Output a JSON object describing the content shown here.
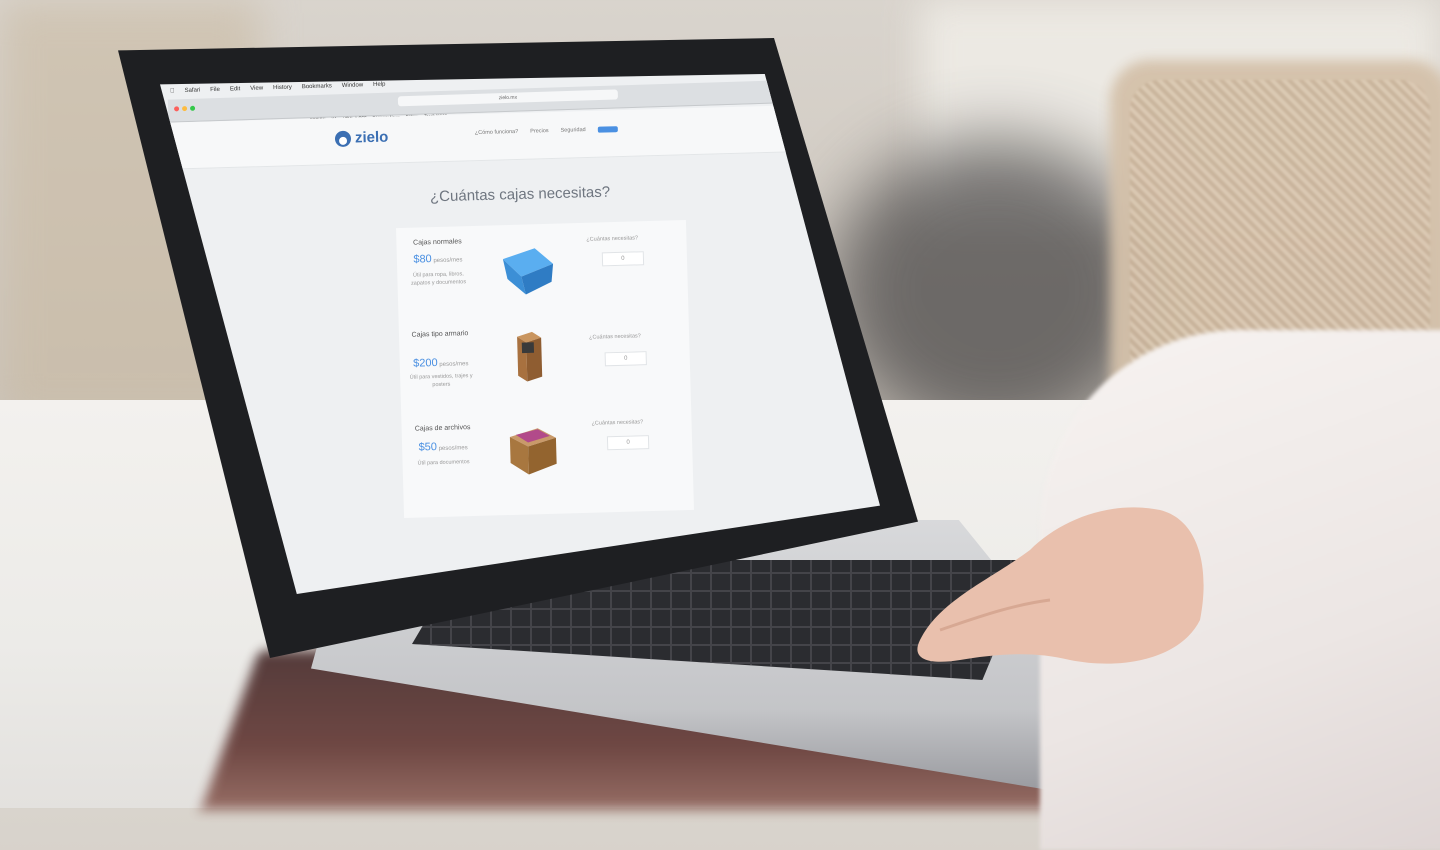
{
  "scene": {
    "description_colors": {
      "screen_bg": "#eef0f2",
      "accent": "#4a90e2",
      "logo": "#3b6fb3"
    }
  },
  "browser": {
    "menu": [
      "Safari",
      "File",
      "Edit",
      "View",
      "History",
      "Bookmarks",
      "Window",
      "Help"
    ],
    "url": "zielo.mx",
    "bookmarks": [
      "DESIGN",
      "XA",
      "HTML & CSS",
      "Designer News",
      "Galaxy",
      "Teach Inman",
      "",
      "",
      ""
    ]
  },
  "site": {
    "logo_text": "zielo",
    "nav": [
      "¿Cómo funciona?",
      "Precios",
      "Seguridad"
    ],
    "nav_button": "",
    "headline": "¿Cuántas cajas necesitas?",
    "items": [
      {
        "label": "Cajas normales",
        "price": "$80",
        "unit": "pesos/mes",
        "desc": "Útil para ropa, libros, zapatos y documentos",
        "qty_label": "¿Cuántas necesitas?",
        "qty_value": "0",
        "icon": "plastic-tote-icon",
        "color": "#4a9ee0"
      },
      {
        "label": "Cajas tipo armario",
        "price": "$200",
        "unit": "pesos/mes",
        "desc": "Útil para vestidos, trajes y posters",
        "qty_label": "¿Cuántas necesitas?",
        "qty_value": "0",
        "icon": "wardrobe-box-icon",
        "color": "#b07a4a"
      },
      {
        "label": "Cajas de archivos",
        "price": "$50",
        "unit": "pesos/mes",
        "desc": "Útil para documentos",
        "qty_label": "¿Cuántas necesitas?",
        "qty_value": "0",
        "icon": "file-box-icon",
        "color": "#b8875a"
      }
    ]
  }
}
